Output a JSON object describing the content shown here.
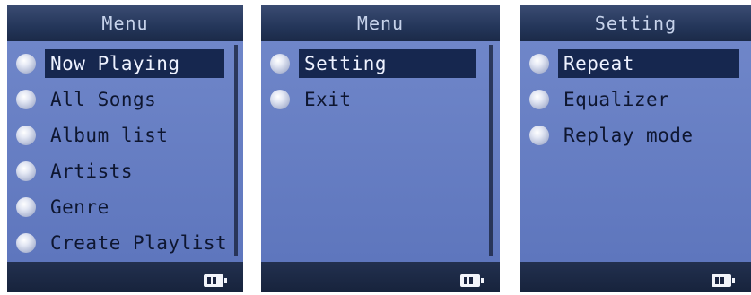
{
  "screens": [
    {
      "title": "Menu",
      "items": [
        "Now Playing",
        "All Songs",
        "Album list",
        "Artists",
        "Genre",
        "Create Playlist"
      ]
    },
    {
      "title": "Menu",
      "items": [
        "Setting",
        "Exit"
      ]
    },
    {
      "title": "Setting",
      "items": [
        "Repeat",
        "Equalizer",
        "Replay mode"
      ]
    }
  ],
  "icons": {
    "bullet": "radio-bullet-icon",
    "battery": "battery-icon"
  },
  "colors": {
    "title_bg": "#24365a",
    "body_bg": "#6f86c9",
    "selected_bg": "#16274f",
    "text": "#0e1630",
    "selected_text": "#eef2ff"
  }
}
